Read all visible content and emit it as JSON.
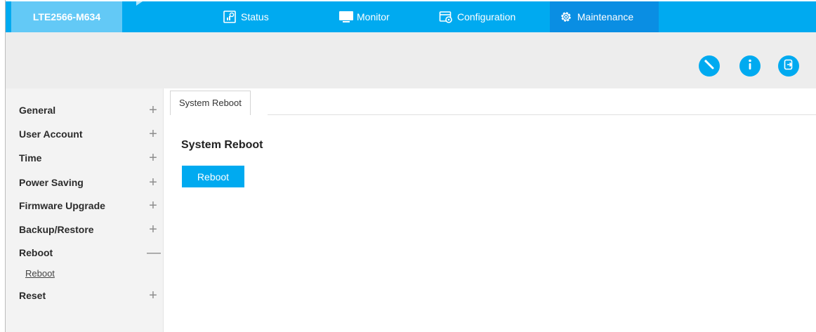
{
  "brand": {
    "model": "LTE2566-M634"
  },
  "nav": [
    {
      "label": "Status",
      "icon": "status-icon"
    },
    {
      "label": "Monitor",
      "icon": "monitor-icon"
    },
    {
      "label": "Configuration",
      "icon": "configuration-icon"
    },
    {
      "label": "Maintenance",
      "icon": "gear-icon",
      "active": true
    }
  ],
  "toolbar": {
    "icons": [
      "wizard-icon",
      "info-icon",
      "logout-icon"
    ]
  },
  "sidebar": {
    "items": [
      {
        "label": "General",
        "sign": "+"
      },
      {
        "label": "User Account",
        "sign": "+"
      },
      {
        "label": "Time",
        "sign": "+"
      },
      {
        "label": "Power Saving",
        "sign": "+"
      },
      {
        "label": "Firmware Upgrade",
        "sign": "+"
      },
      {
        "label": "Backup/Restore",
        "sign": "+"
      },
      {
        "label": "Reboot",
        "sign": "—"
      },
      {
        "label": "Reset",
        "sign": "+"
      }
    ],
    "sub_reboot": "Reboot"
  },
  "content": {
    "tab_label": "System Reboot",
    "section_title": "System Reboot",
    "reboot_button": "Reboot"
  },
  "colors": {
    "accent": "#00aaf0",
    "brand_bg": "#63c9f6",
    "active_nav": "#0a8ee3"
  }
}
